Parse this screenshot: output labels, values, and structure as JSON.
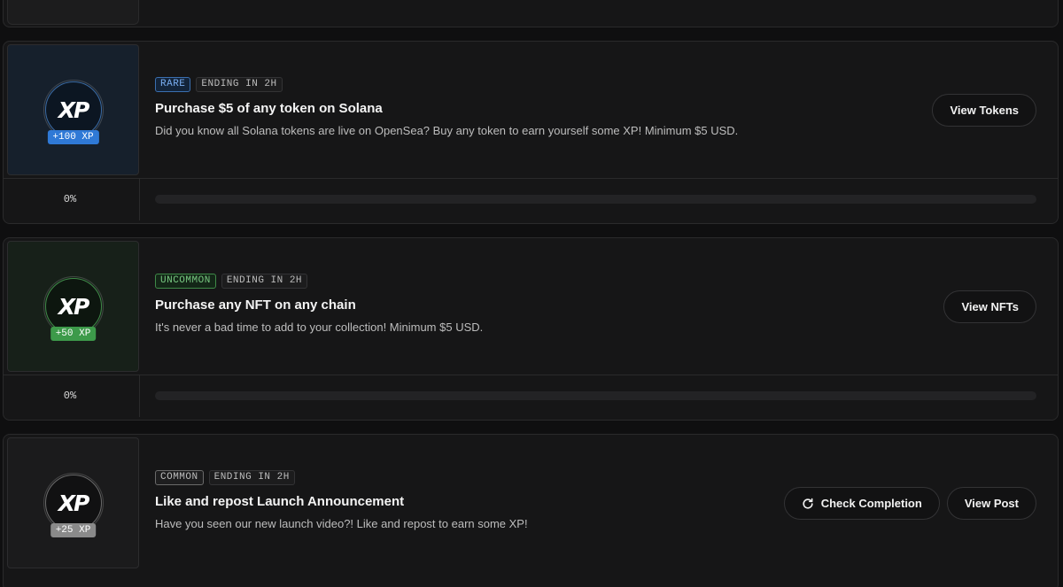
{
  "quests": [
    {
      "rarity": "rare",
      "rarity_label": "RARE",
      "ending": "ENDING IN 2H",
      "xp": "+100 XP",
      "logo": "XP",
      "title": "Purchase $5 of any token on Solana",
      "description": "Did you know all Solana tokens are live on OpenSea? Buy any token to earn yourself some XP! Minimum $5 USD.",
      "primary_action": "View Tokens",
      "progress_label": "0%",
      "progress_value": 0
    },
    {
      "rarity": "uncommon",
      "rarity_label": "UNCOMMON",
      "ending": "ENDING IN 2H",
      "xp": "+50 XP",
      "logo": "XP",
      "title": "Purchase any NFT on any chain",
      "description": "It's never a bad time to add to your collection! Minimum $5 USD.",
      "primary_action": "View NFTs",
      "progress_label": "0%",
      "progress_value": 0
    },
    {
      "rarity": "common",
      "rarity_label": "COMMON",
      "ending": "ENDING IN 2H",
      "xp": "+25 XP",
      "logo": "XP",
      "title": "Like and repost Launch Announcement",
      "description": "Have you seen our new launch video?! Like and repost to earn some XP!",
      "secondary_action": "Check Completion",
      "secondary_icon": "refresh-icon",
      "primary_action": "View Post"
    }
  ],
  "colors": {
    "rare": "#2f79d6",
    "uncommon": "#3d9a4a",
    "common": "#8a8a8a"
  }
}
